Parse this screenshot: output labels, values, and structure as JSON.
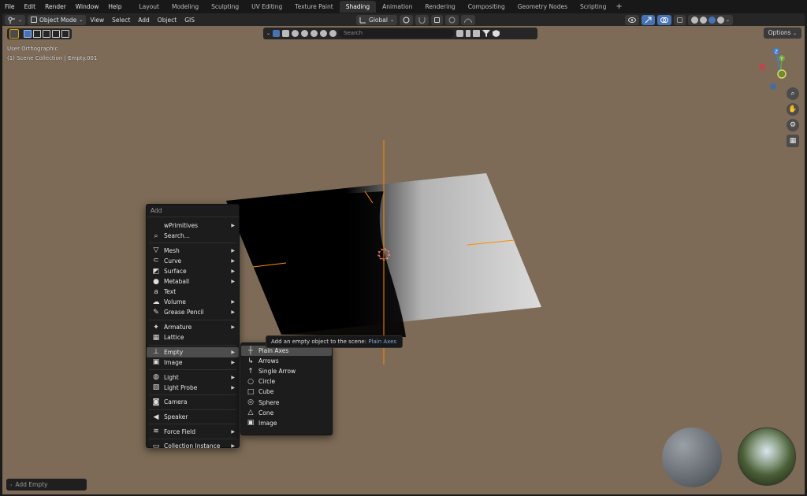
{
  "topbar": {
    "menus": [
      "File",
      "Edit",
      "Render",
      "Window",
      "Help"
    ],
    "workspaces": [
      "Layout",
      "Modeling",
      "Sculpting",
      "UV Editing",
      "Texture Paint",
      "Shading",
      "Animation",
      "Rendering",
      "Compositing",
      "Geometry Nodes",
      "Scripting"
    ],
    "active_workspace": "Shading",
    "add_workspace": "+"
  },
  "header": {
    "mode": "Object Mode",
    "menus": [
      "View",
      "Select",
      "Add",
      "Object",
      "GIS"
    ],
    "transform_orientation": "Global",
    "options_label": "Options",
    "search_placeholder": "Search"
  },
  "viewport": {
    "view_name": "User Orthographic",
    "collection_info": "(1) Scene Collection | Empty.001",
    "background_color": "#7d6b57",
    "gizmo_labels": {
      "z": "Z",
      "y": "Y"
    }
  },
  "add_menu": {
    "title": "Add",
    "items": [
      {
        "label": "wPrimitives",
        "icon": "",
        "submenu": true
      },
      {
        "label": "Search...",
        "icon": "search-icon",
        "submenu": false
      },
      {
        "sep": true
      },
      {
        "label": "Mesh",
        "icon": "mesh-icon",
        "submenu": true
      },
      {
        "label": "Curve",
        "icon": "curve-icon",
        "submenu": true
      },
      {
        "label": "Surface",
        "icon": "surface-icon",
        "submenu": true
      },
      {
        "label": "Metaball",
        "icon": "metaball-icon",
        "submenu": true
      },
      {
        "label": "Text",
        "icon": "text-icon",
        "submenu": false
      },
      {
        "label": "Volume",
        "icon": "volume-icon",
        "submenu": true
      },
      {
        "label": "Grease Pencil",
        "icon": "grease-pencil-icon",
        "submenu": true
      },
      {
        "sep": true
      },
      {
        "label": "Armature",
        "icon": "armature-icon",
        "submenu": true
      },
      {
        "label": "Lattice",
        "icon": "lattice-icon",
        "submenu": false
      },
      {
        "sep": true
      },
      {
        "label": "Empty",
        "icon": "empty-icon",
        "submenu": true,
        "active": true
      },
      {
        "label": "Image",
        "icon": "image-icon",
        "submenu": true
      },
      {
        "sep": true
      },
      {
        "label": "Light",
        "icon": "light-icon",
        "submenu": true
      },
      {
        "label": "Light Probe",
        "icon": "light-probe-icon",
        "submenu": true
      },
      {
        "sep": true
      },
      {
        "label": "Camera",
        "icon": "camera-icon",
        "submenu": false
      },
      {
        "sep": true
      },
      {
        "label": "Speaker",
        "icon": "speaker-icon",
        "submenu": false
      },
      {
        "sep": true
      },
      {
        "label": "Force Field",
        "icon": "force-field-icon",
        "submenu": true
      },
      {
        "sep": true
      },
      {
        "label": "Collection Instance",
        "icon": "collection-instance-icon",
        "submenu": true
      }
    ]
  },
  "empty_submenu": {
    "items": [
      {
        "label": "Plain Axes",
        "icon": "plain-axes-icon",
        "active": true
      },
      {
        "label": "Arrows",
        "icon": "arrows-icon"
      },
      {
        "label": "Single Arrow",
        "icon": "single-arrow-icon"
      },
      {
        "label": "Circle",
        "icon": "circle-icon"
      },
      {
        "label": "Cube",
        "icon": "cube-icon"
      },
      {
        "label": "Sphere",
        "icon": "sphere-icon"
      },
      {
        "label": "Cone",
        "icon": "cone-icon"
      },
      {
        "label": "Image",
        "icon": "image-icon"
      }
    ]
  },
  "tooltip": {
    "text": "Add an empty object to the scene:",
    "highlight": "Plain Axes"
  },
  "last_operator": {
    "label": "Add Empty"
  }
}
